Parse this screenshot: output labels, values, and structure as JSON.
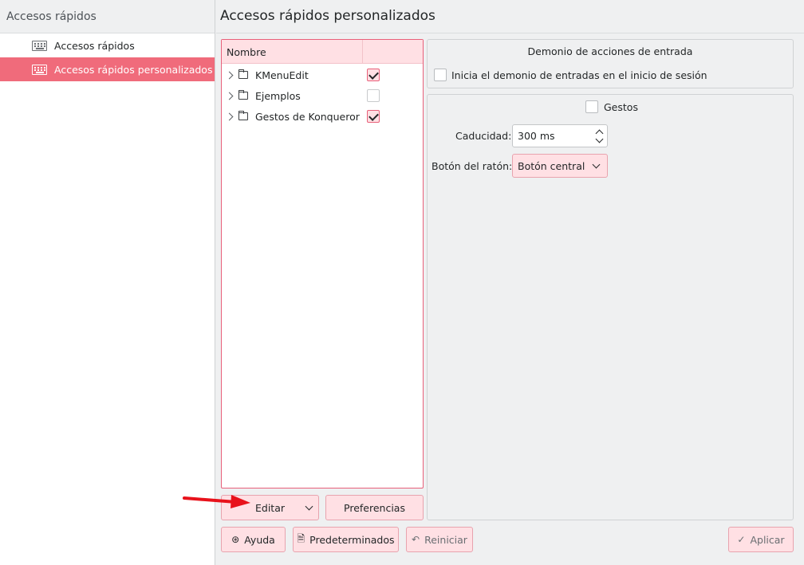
{
  "sidebar": {
    "header": "Accesos rápidos",
    "items": [
      {
        "label": "Accesos rápidos",
        "icon": "keyboard-icon",
        "selected": false
      },
      {
        "label": "Accesos rápidos personalizados",
        "icon": "keyboard-icon",
        "selected": true
      }
    ]
  },
  "main": {
    "title": "Accesos rápidos personalizados",
    "tree": {
      "header_name": "Nombre",
      "rows": [
        {
          "label": "KMenuEdit",
          "checked": true
        },
        {
          "label": "Ejemplos",
          "checked": false
        },
        {
          "label": "Gestos de Konqueror",
          "checked": true
        }
      ]
    },
    "edit_button": "Editar",
    "preferences_button": "Preferencias",
    "input_daemon": {
      "title": "Demonio de acciones de entrada",
      "start_label": "Inicia el demonio de entradas en el inicio de sesión",
      "start_checked": false
    },
    "gestures": {
      "label": "Gestos",
      "checked": false,
      "timeout_label": "Caducidad:",
      "timeout_value": "300 ms",
      "mouse_button_label": "Botón del ratón:",
      "mouse_button_value": "Botón central"
    }
  },
  "footer": {
    "help": "Ayuda",
    "defaults": "Predeterminados",
    "reset": "Reiniciar",
    "apply": "Aplicar"
  },
  "colors": {
    "accent": "#f06b7b",
    "accent_light": "#ffe0e4",
    "annotation_arrow": "#e8121b"
  }
}
